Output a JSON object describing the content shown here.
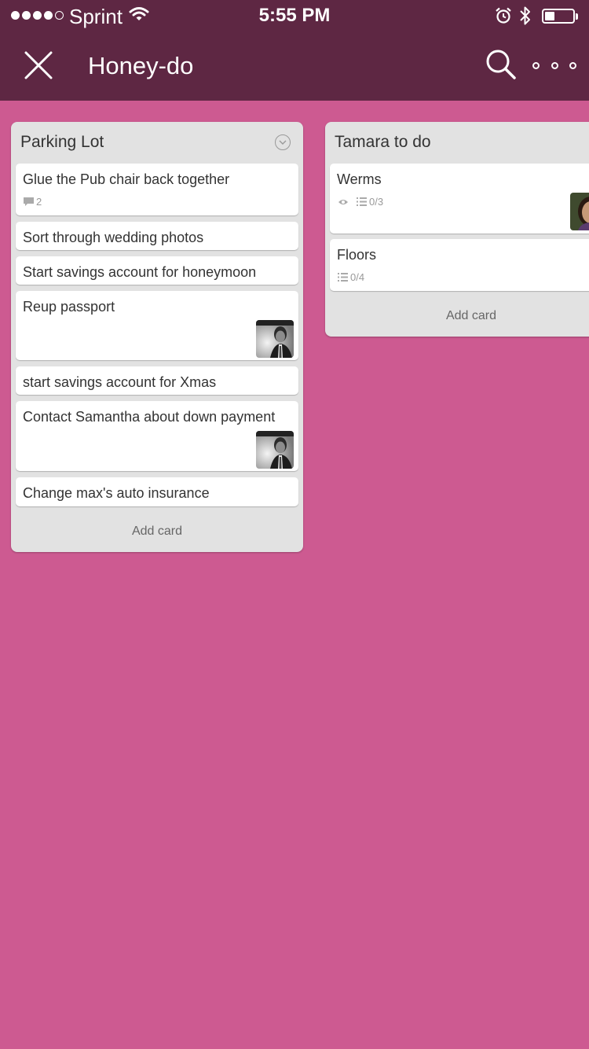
{
  "status_bar": {
    "carrier": "Sprint",
    "time": "5:55 PM",
    "battery_level": 0.35
  },
  "nav": {
    "title": "Honey-do",
    "close_icon": "close-icon",
    "search_icon": "search-icon",
    "more_icon": "more-icon"
  },
  "colors": {
    "nav_bar": "#5e2743",
    "board_background": "#cd5a91",
    "list_background": "#e2e2e2",
    "card_background": "#ffffff"
  },
  "lists": [
    {
      "name": "Parking Lot",
      "add_card_label": "Add card",
      "cards": [
        {
          "title": "Glue the Pub chair back together",
          "comments": "2"
        },
        {
          "title": "Sort through wedding photos"
        },
        {
          "title": "Start savings account for honeymoon"
        },
        {
          "title": "Reup passport",
          "has_avatar": true
        },
        {
          "title": "start savings account for Xmas"
        },
        {
          "title": "Contact Samantha about down payment",
          "has_avatar": true
        },
        {
          "title": "Change max's auto insurance"
        }
      ]
    },
    {
      "name": "Tamara to do",
      "add_card_label": "Add card",
      "cards": [
        {
          "title": "Werms",
          "watching": true,
          "checklist": "0/3",
          "has_avatar": true
        },
        {
          "title": "Floors",
          "checklist": "0/4"
        }
      ]
    }
  ]
}
